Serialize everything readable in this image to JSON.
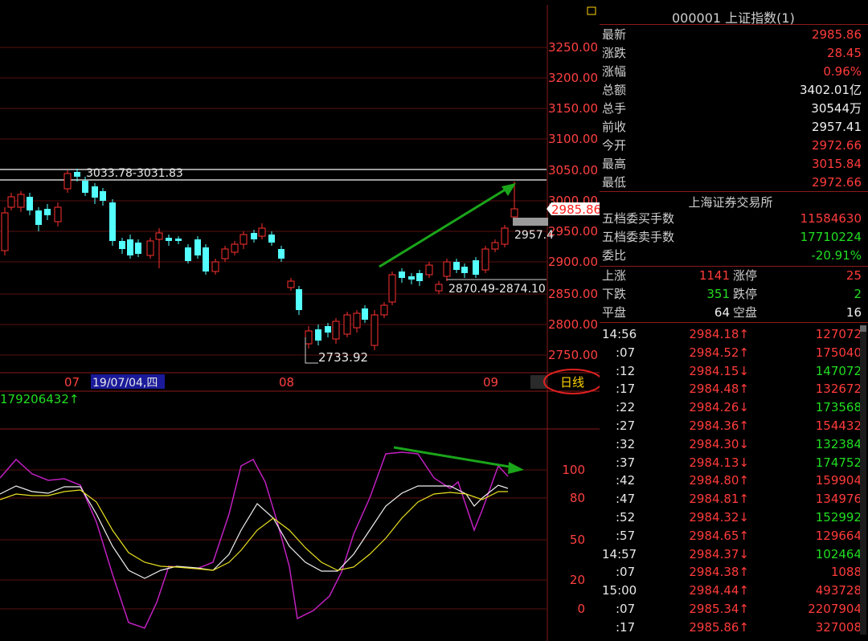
{
  "chart_labels": {
    "price_axis": [
      "3250.00",
      "3200.00",
      "3150.00",
      "3100.00",
      "3050.00",
      "3000.00",
      "2950.00",
      "2900.00",
      "2850.00",
      "2800.00",
      "2750.00"
    ],
    "current_price_tag": "2985.86",
    "prev_close_tag": "2957.4",
    "annotation_high": "3033.78-3031.83",
    "annotation_mid": "2870.49-2874.10",
    "annotation_low": "2733.92",
    "date_axis": [
      "07",
      "08",
      "09"
    ],
    "cursor_date": "19/07/04,四",
    "period_button": "日线",
    "volume_label": "179206432↑",
    "indicator_axis": [
      "100",
      "80",
      "50",
      "20",
      "0"
    ]
  },
  "quote": {
    "title": "000001 上证指数(1)",
    "rows": [
      {
        "label": "最新",
        "value": "2985.86",
        "color": "red"
      },
      {
        "label": "涨跌",
        "value": "28.45",
        "color": "red"
      },
      {
        "label": "涨幅",
        "value": "0.96%",
        "color": "red"
      },
      {
        "label": "总额",
        "value": "3402.01亿",
        "color": "white"
      },
      {
        "label": "总手",
        "value": "30544万",
        "color": "white"
      },
      {
        "label": "前收",
        "value": "2957.41",
        "color": "white"
      },
      {
        "label": "今开",
        "value": "2972.66",
        "color": "red"
      },
      {
        "label": "最高",
        "value": "3015.84",
        "color": "red"
      },
      {
        "label": "最低",
        "value": "2972.66",
        "color": "red"
      }
    ],
    "exchange": "上海证券交易所",
    "orders": [
      {
        "label": "五档委买手数",
        "value": "11584630",
        "color": "red"
      },
      {
        "label": "五档委卖手数",
        "value": "17710224",
        "color": "green"
      },
      {
        "label": "委比",
        "value": "-20.91%",
        "color": "green"
      }
    ],
    "breadth": [
      {
        "l1": "上涨",
        "v1": "1141",
        "c1": "red",
        "l2": "涨停",
        "v2": "25",
        "c2": "red"
      },
      {
        "l1": "下跌",
        "v1": "351",
        "c1": "green",
        "l2": "跌停",
        "v2": "2",
        "c2": "green"
      },
      {
        "l1": "平盘",
        "v1": "64",
        "c1": "white",
        "l2": "空盘",
        "v2": "16",
        "c2": "white"
      }
    ]
  },
  "ticks": [
    {
      "time": "14:56",
      "price": "2984.18↑",
      "pc": "red",
      "vol": "127072",
      "vc": "red"
    },
    {
      "time": ":07",
      "price": "2984.52↑",
      "pc": "red",
      "vol": "175040",
      "vc": "red"
    },
    {
      "time": ":12",
      "price": "2984.15↓",
      "pc": "red",
      "vol": "147072",
      "vc": "green"
    },
    {
      "time": ":17",
      "price": "2984.48↑",
      "pc": "red",
      "vol": "132672",
      "vc": "red"
    },
    {
      "time": ":22",
      "price": "2984.26↓",
      "pc": "red",
      "vol": "173568",
      "vc": "green"
    },
    {
      "time": ":27",
      "price": "2984.36↑",
      "pc": "red",
      "vol": "154432",
      "vc": "red"
    },
    {
      "time": ":32",
      "price": "2984.30↓",
      "pc": "red",
      "vol": "132384",
      "vc": "green"
    },
    {
      "time": ":37",
      "price": "2984.13↓",
      "pc": "red",
      "vol": "174752",
      "vc": "green"
    },
    {
      "time": ":42",
      "price": "2984.80↑",
      "pc": "red",
      "vol": "159904",
      "vc": "red"
    },
    {
      "time": ":47",
      "price": "2984.81↑",
      "pc": "red",
      "vol": "134976",
      "vc": "red"
    },
    {
      "time": ":52",
      "price": "2984.32↓",
      "pc": "red",
      "vol": "152992",
      "vc": "green"
    },
    {
      "time": ":57",
      "price": "2984.65↑",
      "pc": "red",
      "vol": "129664",
      "vc": "red"
    },
    {
      "time": "14:57",
      "price": "2984.37↓",
      "pc": "red",
      "vol": "102464",
      "vc": "green"
    },
    {
      "time": ":07",
      "price": "2984.38↑",
      "pc": "red",
      "vol": "1088",
      "vc": "red"
    },
    {
      "time": "15:00",
      "price": "2984.44↑",
      "pc": "red",
      "vol": "493728",
      "vc": "red"
    },
    {
      "time": ":07",
      "price": "2985.34↑",
      "pc": "red",
      "vol": "2207904",
      "vc": "red"
    },
    {
      "time": ":17",
      "price": "2985.86↑",
      "pc": "red",
      "vol": "327008",
      "vc": "red"
    }
  ]
}
